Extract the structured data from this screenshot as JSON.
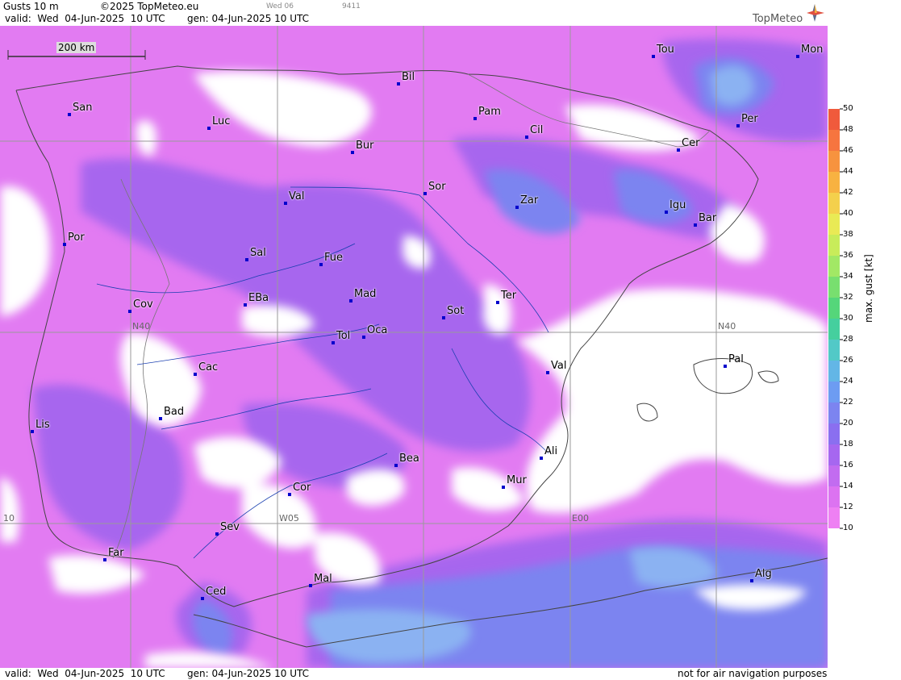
{
  "header": {
    "title": "Gusts 10 m",
    "copyright": "©2025 TopMeteo.eu",
    "tab_day": "Wed 06",
    "tab_code": "9411",
    "valid": "valid:  Wed  04-Jun-2025  10 UTC",
    "gen": "gen: 04-Jun-2025 10 UTC",
    "brand": "TopMeteo"
  },
  "footer": {
    "valid": "valid:  Wed  04-Jun-2025  10 UTC",
    "gen": "gen: 04-Jun-2025 10 UTC",
    "notice": "not for air navigation purposes"
  },
  "scale_bar": {
    "label": "200 km"
  },
  "grid_labels": {
    "n40_left": "N40",
    "n40_right": "N40",
    "w05": "W05",
    "e00": "E00",
    "w10": "10"
  },
  "cities": [
    {
      "name": "Tou"
    },
    {
      "name": "Mon"
    },
    {
      "name": "Bil"
    },
    {
      "name": "San"
    },
    {
      "name": "Pam"
    },
    {
      "name": "Per"
    },
    {
      "name": "Luc"
    },
    {
      "name": "Cil"
    },
    {
      "name": "Cer"
    },
    {
      "name": "Bur"
    },
    {
      "name": "Sor"
    },
    {
      "name": "Val"
    },
    {
      "name": "Zar"
    },
    {
      "name": "Igu"
    },
    {
      "name": "Bar"
    },
    {
      "name": "Por"
    },
    {
      "name": "Sal"
    },
    {
      "name": "Fue"
    },
    {
      "name": "Mad"
    },
    {
      "name": "Ter"
    },
    {
      "name": "Cov"
    },
    {
      "name": "EBa"
    },
    {
      "name": "Sot"
    },
    {
      "name": "Tol"
    },
    {
      "name": "Oca"
    },
    {
      "name": "Pal"
    },
    {
      "name": "Cac"
    },
    {
      "name": "Val"
    },
    {
      "name": "Bad"
    },
    {
      "name": "Lis"
    },
    {
      "name": "Ali"
    },
    {
      "name": "Bea"
    },
    {
      "name": "Mur"
    },
    {
      "name": "Cor"
    },
    {
      "name": "Sev"
    },
    {
      "name": "Far"
    },
    {
      "name": "Alg"
    },
    {
      "name": "Mal"
    },
    {
      "name": "Ced"
    }
  ],
  "legend": {
    "unit_label": "max. gust [kt]",
    "ticks": [
      "50",
      "48",
      "46",
      "44",
      "42",
      "40",
      "38",
      "36",
      "34",
      "32",
      "30",
      "28",
      "26",
      "24",
      "22",
      "20",
      "18",
      "16",
      "14",
      "12",
      "10"
    ],
    "colors": [
      "#f05a3c",
      "#f6753f",
      "#f7933f",
      "#f8b241",
      "#f4d04c",
      "#e9ea55",
      "#c8ec5a",
      "#a2e865",
      "#78df6f",
      "#55d67a",
      "#45cf9e",
      "#52c9c7",
      "#63b6e6",
      "#6d9cf2",
      "#7c84f0",
      "#8a6ff0",
      "#a667f0",
      "#c26cf0",
      "#dc73f1",
      "#ee80f3"
    ]
  },
  "colors": {
    "calm": "#ffffff",
    "light": "#e27bf2",
    "moderate": "#a766ee",
    "fresh": "#7c84f0",
    "strong": "#8bb2f2"
  }
}
